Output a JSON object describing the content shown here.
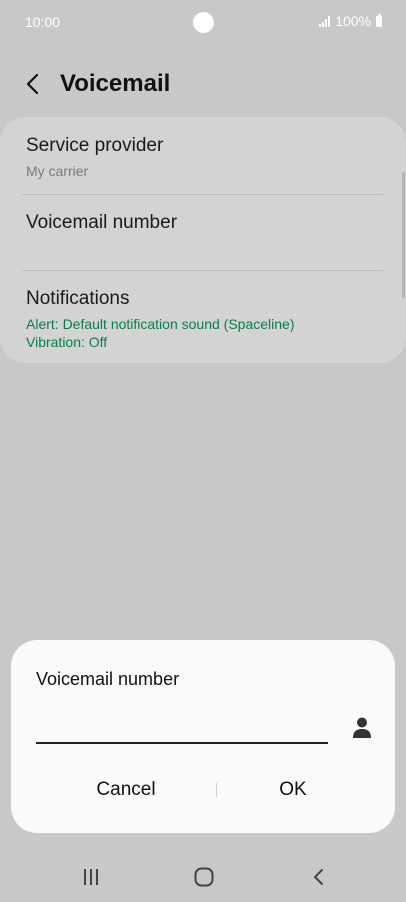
{
  "status": {
    "time": "10:00",
    "battery": "100%"
  },
  "header": {
    "title": "Voicemail"
  },
  "settings": [
    {
      "title": "Service provider",
      "subtitle": "My carrier"
    },
    {
      "title": "Voicemail number",
      "subtitle": ""
    },
    {
      "title": "Notifications",
      "alert": "Alert: Default notification sound (Spaceline)",
      "vibration": "Vibration: Off"
    }
  ],
  "dialog": {
    "title": "Voicemail number",
    "input_value": "",
    "cancel_label": "Cancel",
    "ok_label": "OK"
  },
  "icons": {
    "back": "back-arrow-icon",
    "contact": "person-icon",
    "recents": "recents-icon",
    "home": "home-icon",
    "nav_back": "nav-back-icon"
  }
}
